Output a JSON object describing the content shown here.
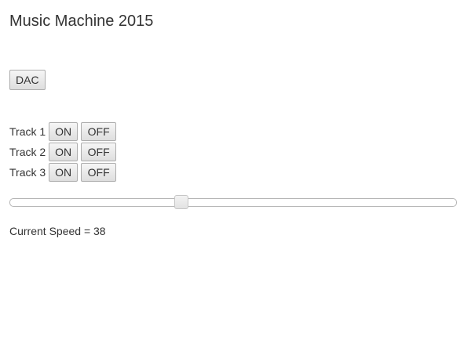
{
  "header": {
    "title": "Music Machine 2015"
  },
  "controls": {
    "dac_label": "DAC"
  },
  "tracks": [
    {
      "label": "Track 1",
      "on_label": "ON",
      "off_label": "OFF"
    },
    {
      "label": "Track 2",
      "on_label": "ON",
      "off_label": "OFF"
    },
    {
      "label": "Track 3",
      "on_label": "ON",
      "off_label": "OFF"
    }
  ],
  "speed": {
    "text": "Current Speed = 38",
    "value": 38,
    "min": 0,
    "max": 100
  }
}
